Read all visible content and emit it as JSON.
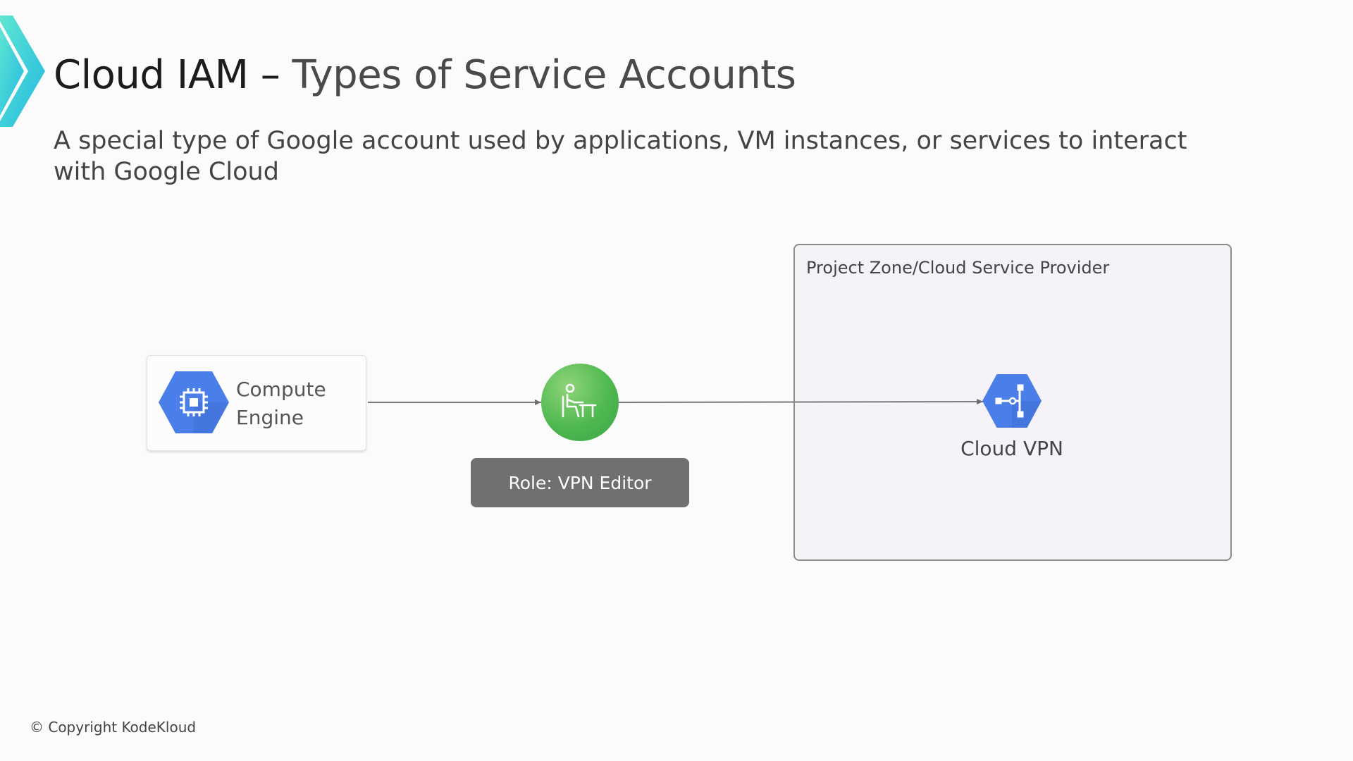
{
  "slide": {
    "title_main": "Cloud IAM – ",
    "title_accent": "Types of Service Accounts",
    "subtitle": "A special type of Google account used by applications, VM instances, or services to interact with Google Cloud"
  },
  "diagram": {
    "compute_engine": {
      "label": "Compute Engine",
      "icon": "compute-engine-chip-icon"
    },
    "service_account": {
      "icon": "person-at-desk-icon",
      "role_label": "Role: VPN Editor"
    },
    "project_zone": {
      "label": "Project Zone/Cloud Service Provider"
    },
    "cloud_vpn": {
      "label": "Cloud VPN",
      "icon": "cloud-vpn-icon"
    }
  },
  "footer": {
    "copyright": "© Copyright KodeKloud"
  },
  "colors": {
    "accent_cyan": "#36d3e0",
    "google_blue": "#4a7ee8",
    "service_account_green": "#4fb84f",
    "role_badge_gray": "#707070",
    "zone_border": "#8c8c8c"
  }
}
